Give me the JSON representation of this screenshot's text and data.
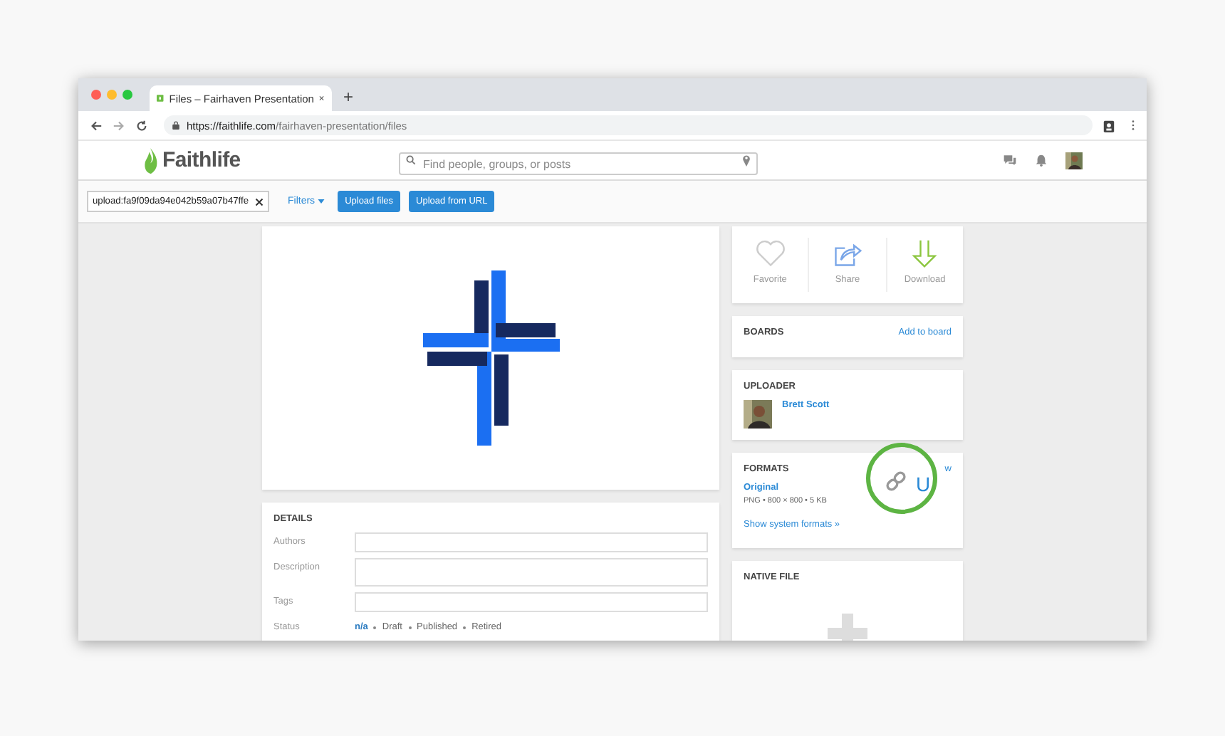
{
  "browser": {
    "tab_title": "Files – Fairhaven Presentation",
    "new_tab": "+",
    "url_host": "https://faithlife.com",
    "url_path": "/fairhaven-presentation/files"
  },
  "site": {
    "logo": "Faithlife",
    "search": {
      "placeholder": "Find people, groups, or posts"
    }
  },
  "toolbar": {
    "filter_field": {
      "value": "upload:fa9f09da94e042b59a07b47ffe"
    },
    "filters": "Filters",
    "buttons": [
      "Upload files",
      "Upload from URL"
    ]
  },
  "details": {
    "title": "DETAILS",
    "fields": [
      {
        "label": "Authors",
        "kind": "line"
      },
      {
        "label": "Description",
        "kind": "area"
      },
      {
        "label": "Tags",
        "kind": "line"
      }
    ],
    "status": {
      "label": "Status",
      "options": [
        {
          "label": "n/a",
          "selected": true
        },
        {
          "label": "Draft",
          "selected": false
        },
        {
          "label": "Published",
          "selected": false
        },
        {
          "label": "Retired",
          "selected": false
        }
      ]
    }
  },
  "actions": [
    {
      "label": "Favorite",
      "kind": "heart"
    },
    {
      "label": "Share",
      "kind": "share"
    },
    {
      "label": "Download",
      "kind": "download"
    }
  ],
  "boards": {
    "title": "BOARDS",
    "link": "Add to board"
  },
  "uploader": {
    "title": "UPLOADER",
    "name": "Brett Scott"
  },
  "formats": {
    "title": "FORMATS",
    "cut_link": "w",
    "original": "Original",
    "meta": "PNG • 800 × 800 • 5 KB",
    "more": "Show system formats »",
    "overlay_text": "U"
  },
  "native_file": {
    "title": "NATIVE FILE"
  }
}
